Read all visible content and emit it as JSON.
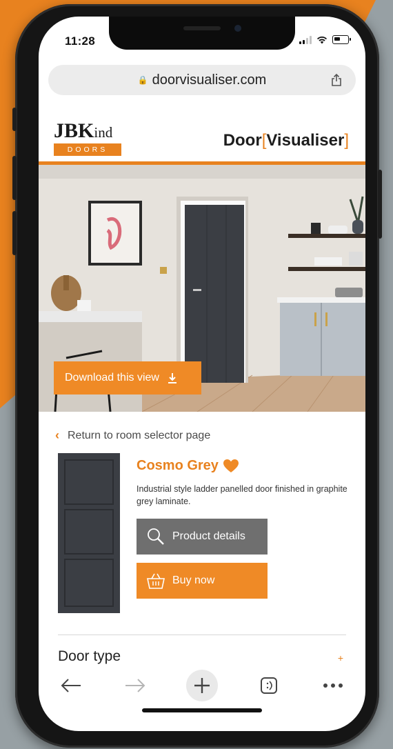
{
  "status": {
    "time": "11:28"
  },
  "browser": {
    "url": "doorvisualiser.com"
  },
  "header": {
    "logo": {
      "main": "JBK",
      "suffix": "ind",
      "sub": "DOORS"
    },
    "brand": {
      "part1": "Door",
      "part2": "Visualiser"
    }
  },
  "hero": {
    "download_label": "Download this view"
  },
  "product": {
    "back_label": "Return to room selector page",
    "name": "Cosmo Grey",
    "description": "Industrial style ladder panelled door finished in graphite grey laminate.",
    "details_label": "Product details",
    "buy_label": "Buy now"
  },
  "section": {
    "door_type_label": "Door type",
    "expand_symbol": "+"
  },
  "icons": [
    "lock-icon",
    "share-icon",
    "download-icon",
    "chevron-left-icon",
    "heart-icon",
    "magnifier-icon",
    "basket-icon",
    "back-arrow-icon",
    "forward-arrow-icon",
    "new-tab-plus-icon",
    "tabs-icon",
    "more-icon"
  ],
  "colors": {
    "accent": "#e8821f",
    "button_grey": "#6f6f6f",
    "door": "#3b3e44"
  }
}
